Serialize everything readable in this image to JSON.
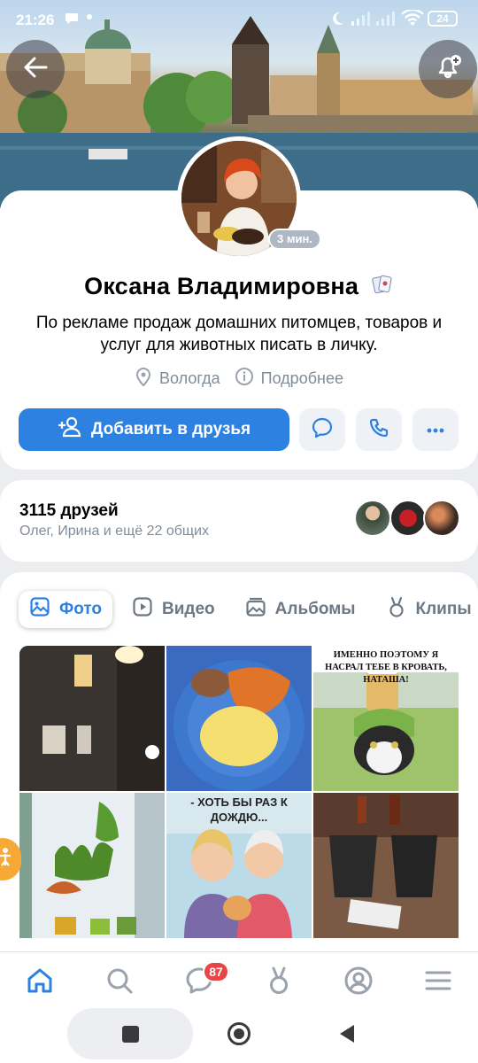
{
  "status_bar": {
    "time": "21:26",
    "battery": "24"
  },
  "profile": {
    "online_status": "3 мин.",
    "name": "Оксана Владимировна",
    "bio": "По рекламе продаж домашних питомцев, товаров и услуг для животных писать в личку.",
    "city": "Вологда",
    "details_label": "Подробнее"
  },
  "actions": {
    "add_friend_label": "Добавить в друзья"
  },
  "friends": {
    "count_label": "3115 друзей",
    "mutual_label": "Олег, Ирина и ещё 22 общих"
  },
  "tabs": [
    {
      "label": "Фото"
    },
    {
      "label": "Видео"
    },
    {
      "label": "Альбомы"
    },
    {
      "label": "Клипы"
    }
  ],
  "photos": {
    "cat_caption": "ИМЕННО ПОЭТОМУ Я НАСРАЛ ТЕБЕ В КРОВАТЬ, НАТАША!",
    "ladies_caption": "- ХОТЬ БЫ РАЗ К ДОЖДЮ..."
  },
  "bottom_nav": {
    "messages_badge": "87"
  },
  "colors": {
    "accent": "#2d81e0",
    "background": "#ebedf0",
    "badge": "#e64646",
    "fab": "#f8a837"
  }
}
